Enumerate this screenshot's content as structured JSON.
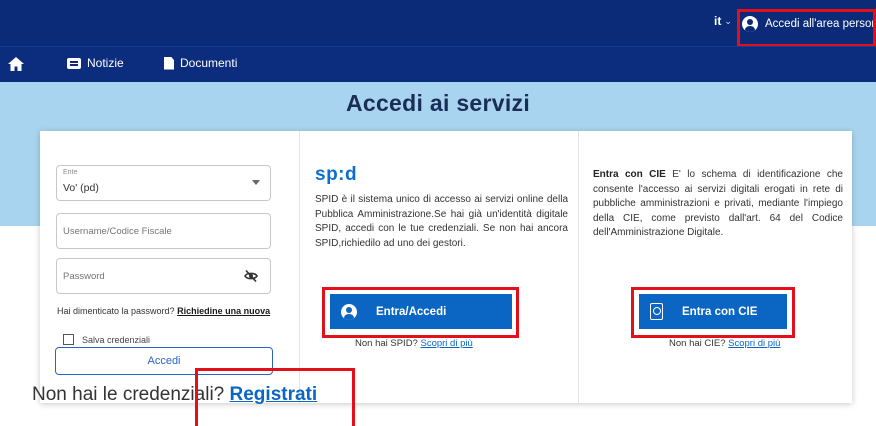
{
  "topbar": {
    "lang": "it",
    "lang_caret": "⌄",
    "login": "Accedi all'area personale"
  },
  "nav": {
    "home_icon": "home-icon",
    "items": [
      {
        "label": "Notizie",
        "icon": "newspaper-icon"
      },
      {
        "label": "Documenti",
        "icon": "document-icon"
      }
    ]
  },
  "hero": {
    "title": "Accedi ai servizi"
  },
  "login_form": {
    "ente_label": "Ente",
    "ente_value": "Vo' (pd)",
    "username_placeholder": "Username/Codice Fiscale",
    "password_placeholder": "Password",
    "forgot_text": "Hai dimenticato la password?",
    "forgot_link": "Richiedine una nuova",
    "remember_label": "Salva credenziali",
    "submit_label": "Accedi"
  },
  "spid": {
    "logo": "sp:d",
    "description": "SPID è il sistema unico di accesso ai servizi online della Pubblica Amministrazione.Se hai già un'identità digitale SPID, accedi con le tue credenziali. Se non hai ancora SPID,richiedilo ad uno dei gestori.",
    "button_label": "Entra/Accedi",
    "footer_text": "Non hai SPID?",
    "footer_link": "Scopri di più"
  },
  "cie": {
    "title": "Entra con CIE",
    "description": "E' lo schema di identificazione che consente l'accesso ai servizi digitali erogati in rete di pubbliche amministrazioni e privati, mediante l'impiego della CIE, come previsto dall'art. 64 del Codice dell'Amministrazione Digitale.",
    "button_label": "Entra con CIE",
    "footer_text": "Non hai CIE?",
    "footer_link": "Scopri di più"
  },
  "register": {
    "text": "Non hai le credenziali?",
    "link": "Registrati"
  },
  "colors": {
    "topbar": "#0b2a78",
    "hero": "#a9d4ef",
    "primary": "#0b66c3",
    "highlight": "#e3101b"
  }
}
